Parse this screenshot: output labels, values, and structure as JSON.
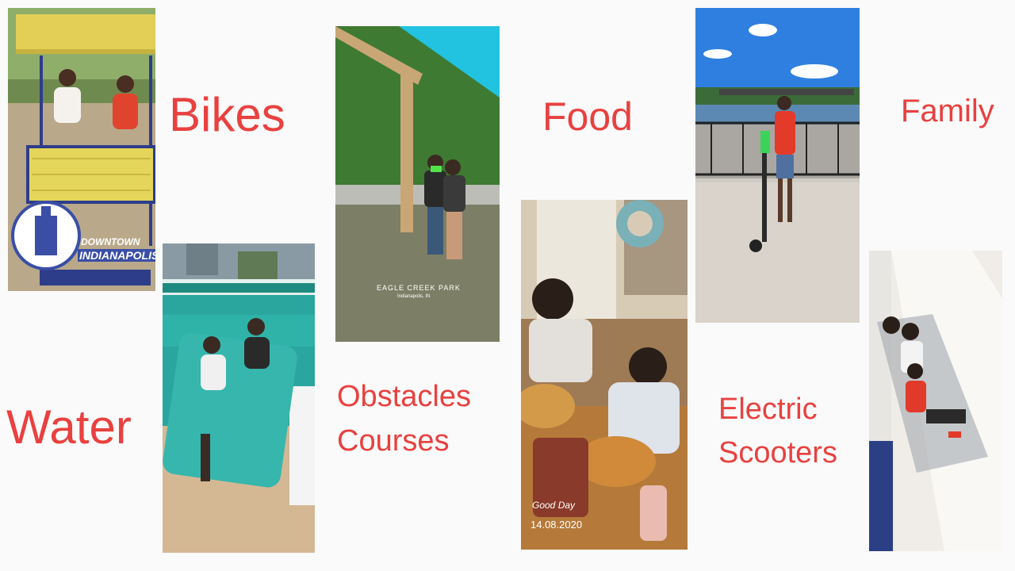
{
  "slide": {
    "labels": {
      "bikes": "Bikes",
      "water": "Water",
      "obstacles_line1": "Obstacles",
      "obstacles_line2": "Courses",
      "food": "Food",
      "electric_line1": "Electric",
      "electric_line2": "Scooters",
      "family": "Family"
    },
    "photos": {
      "surrey_bike": {
        "logo_line1": "DOWNTOWN",
        "logo_line2": "INDIANAPOLIS"
      },
      "park": {
        "sticker_title": "EAGLE CREEK PARK",
        "sticker_subtitle": "Indianapolis, IN"
      },
      "food": {
        "sticker_line1": "Good Day",
        "sticker_line2": "14.08.2020"
      }
    },
    "colors": {
      "label_red": "#e8413f",
      "background": "#fafafa"
    }
  }
}
